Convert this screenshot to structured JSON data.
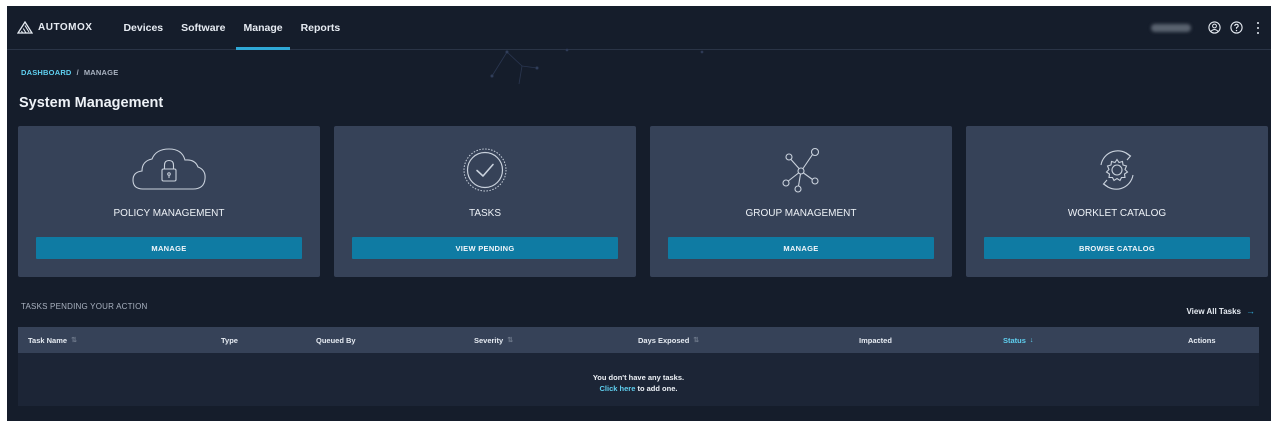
{
  "nav": {
    "brand": "AUTOMOX",
    "items": [
      {
        "label": "Devices",
        "active": false
      },
      {
        "label": "Software",
        "active": false
      },
      {
        "label": "Manage",
        "active": true
      },
      {
        "label": "Reports",
        "active": false
      }
    ],
    "icons": [
      "user-circle-icon",
      "help-icon",
      "more-vertical-icon"
    ]
  },
  "breadcrumb": {
    "root": "DASHBOARD",
    "separator": "/",
    "current": "MANAGE"
  },
  "page_title": "System Management",
  "cards": [
    {
      "icon": "cloud-lock-icon",
      "label": "POLICY MANAGEMENT",
      "button": "MANAGE"
    },
    {
      "icon": "check-circle-icon",
      "label": "TASKS",
      "button": "VIEW PENDING"
    },
    {
      "icon": "network-nodes-icon",
      "label": "GROUP MANAGEMENT",
      "button": "MANAGE"
    },
    {
      "icon": "gear-cycle-icon",
      "label": "WORKLET CATALOG",
      "button": "BROWSE CATALOG"
    }
  ],
  "tasks_section": {
    "title": "TASKS PENDING YOUR ACTION",
    "view_all": "View All Tasks",
    "view_all_arrow": "→",
    "columns": [
      {
        "label": "Task Name",
        "sortable": true
      },
      {
        "label": "Type",
        "sortable": false
      },
      {
        "label": "Queued By",
        "sortable": false
      },
      {
        "label": "Severity",
        "sortable": true
      },
      {
        "label": "Days Exposed",
        "sortable": true
      },
      {
        "label": "Impacted",
        "sortable": false
      },
      {
        "label": "Status",
        "sortable": true,
        "sorted": "desc",
        "sort_glyph": "↓"
      },
      {
        "label": "Actions",
        "sortable": false
      }
    ],
    "sort_glyph": "⇅",
    "empty_message": "You don't have any tasks.",
    "empty_link": "Click here",
    "empty_suffix": " to add one."
  },
  "colors": {
    "background": "#151d2b",
    "card": "#364258",
    "button": "#0f7ba3",
    "accent": "#2fa8d6",
    "link": "#5fd0f0"
  }
}
